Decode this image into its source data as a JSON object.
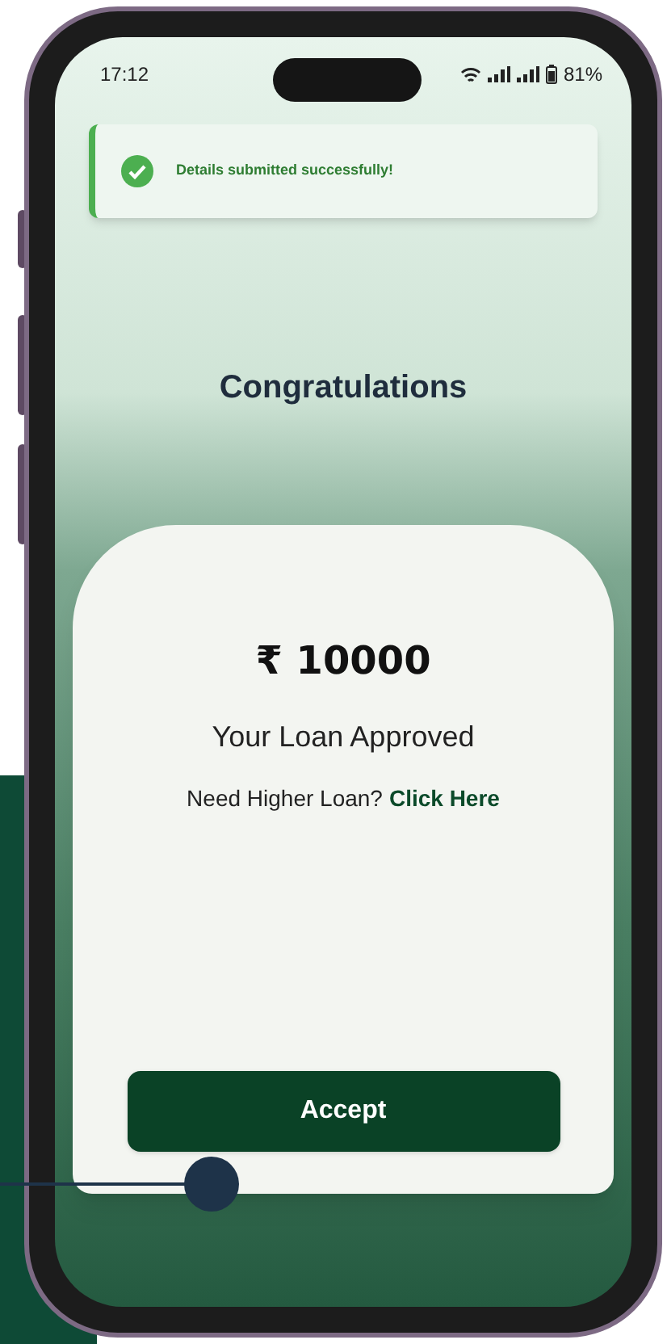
{
  "status_bar": {
    "time": "17:12",
    "battery": "81%"
  },
  "toast": {
    "message": "Details submitted successfully!"
  },
  "heading": "Congratulations",
  "card": {
    "amount": "₹ 10000",
    "status": "Your Loan Approved",
    "prompt": "Need Higher Loan?",
    "link": "Click Here"
  },
  "button": "Accept"
}
